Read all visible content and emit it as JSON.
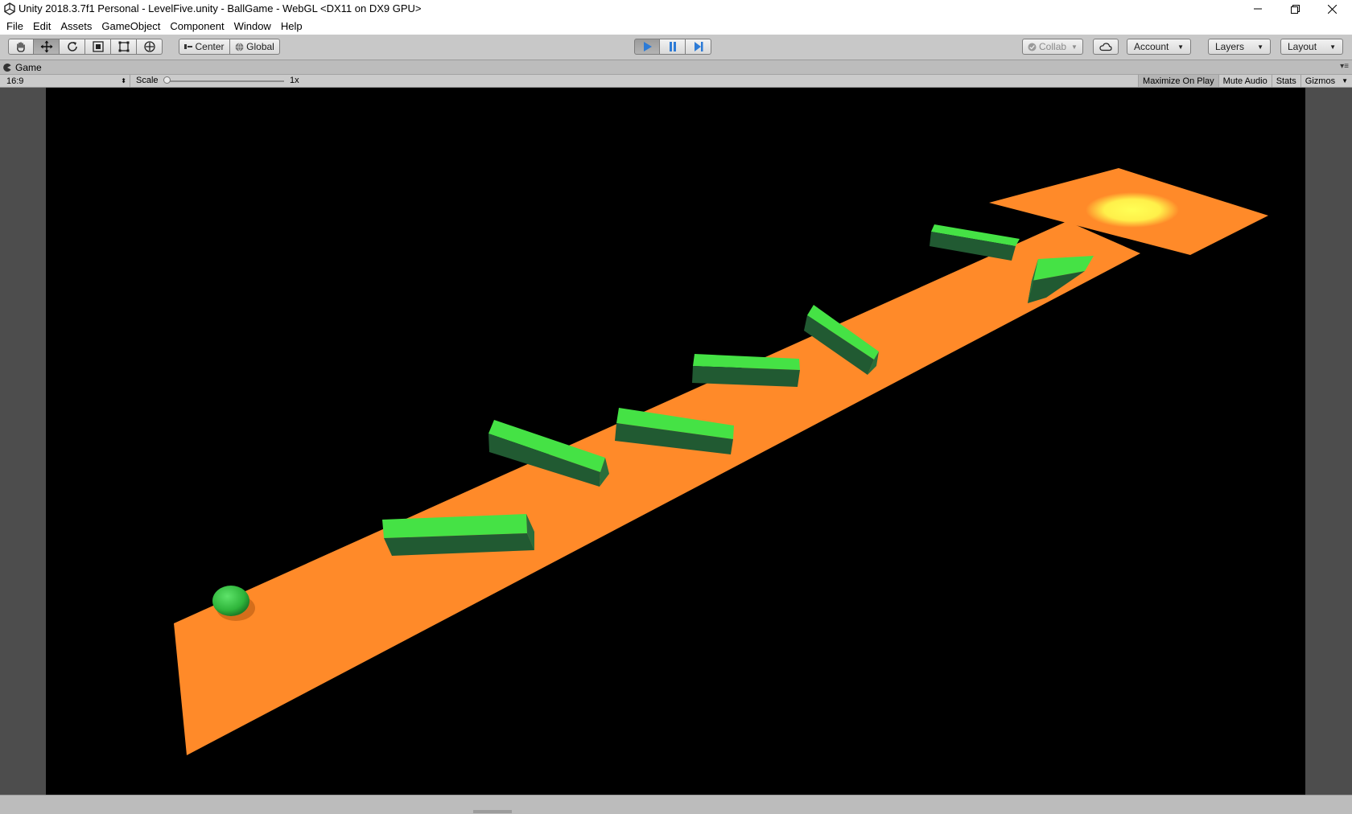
{
  "window": {
    "title": "Unity 2018.3.7f1 Personal - LevelFive.unity - BallGame - WebGL <DX11 on DX9 GPU>"
  },
  "menu": [
    "File",
    "Edit",
    "Assets",
    "GameObject",
    "Component",
    "Window",
    "Help"
  ],
  "toolbar": {
    "tools": [
      "hand-icon",
      "move-icon",
      "rotate-icon",
      "scale-icon",
      "rect-icon",
      "transform-icon"
    ],
    "active_tool": "move-icon",
    "pivot_label": "Center",
    "space_label": "Global",
    "collab_label": "Collab",
    "account_label": "Account",
    "layers_label": "Layers",
    "layout_label": "Layout",
    "play_active": true
  },
  "game_tab": {
    "title": "Game"
  },
  "game_bar": {
    "aspect": "16:9",
    "scale_label": "Scale",
    "scale_value": "1x",
    "scale_level": 0,
    "maximize_label": "Maximize On Play",
    "mute_label": "Mute Audio",
    "stats_label": "Stats",
    "gizmos_label": "Gizmos"
  },
  "colors": {
    "floor": "#ff8a29",
    "floor_edge": "#e67a1e",
    "wall_top": "#45e245",
    "wall_side": "#215a32",
    "ball": "#2fb53b",
    "goal": "#ffff44",
    "play_blue": "#2d7bd6",
    "sky": "#000000"
  }
}
